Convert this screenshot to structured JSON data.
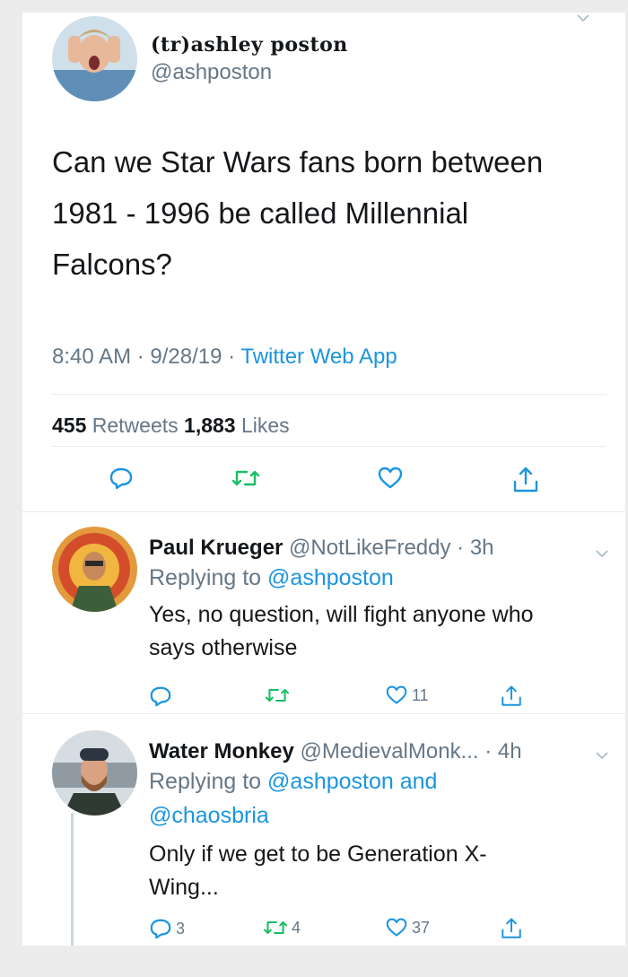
{
  "main_tweet": {
    "display_name": "(tr)ashley poston",
    "handle": "@ashposton",
    "text_lines": [
      "Can we Star Wars fans born between",
      "1981 - 1996 be called Millennial",
      "Falcons?"
    ],
    "timestamp": "8:40 AM · 9/28/19 · ",
    "source": "Twitter Web App",
    "retweet_count": "455",
    "retweet_label": " Retweets ",
    "like_count": "1,883",
    "like_label": " Likes"
  },
  "replies": [
    {
      "name": "Paul Krueger",
      "handle": " @NotLikeFreddy · 3h",
      "replying_prefix": "Replying to ",
      "replying_lines": [
        "@ashposton"
      ],
      "text_lines": [
        "Yes, no question, will fight anyone who",
        "says otherwise"
      ],
      "reply_count": "",
      "retweet_count": "",
      "like_count": "11"
    },
    {
      "name": "Water Monkey",
      "handle": " @MedievalMonk... · 4h",
      "replying_prefix": "Replying to ",
      "replying_lines": [
        "@ashposton and",
        "@chaosbria"
      ],
      "text_lines": [
        "Only if we get to be Generation X-",
        "Wing..."
      ],
      "reply_count": "3",
      "retweet_count": "4",
      "like_count": "37"
    }
  ],
  "colors": {
    "link": "#1b95e0",
    "retweet_green": "#17bf63",
    "secondary": "#657786"
  },
  "icons": [
    "reply-icon",
    "retweet-icon",
    "like-icon",
    "share-icon",
    "chevron-down-icon"
  ]
}
